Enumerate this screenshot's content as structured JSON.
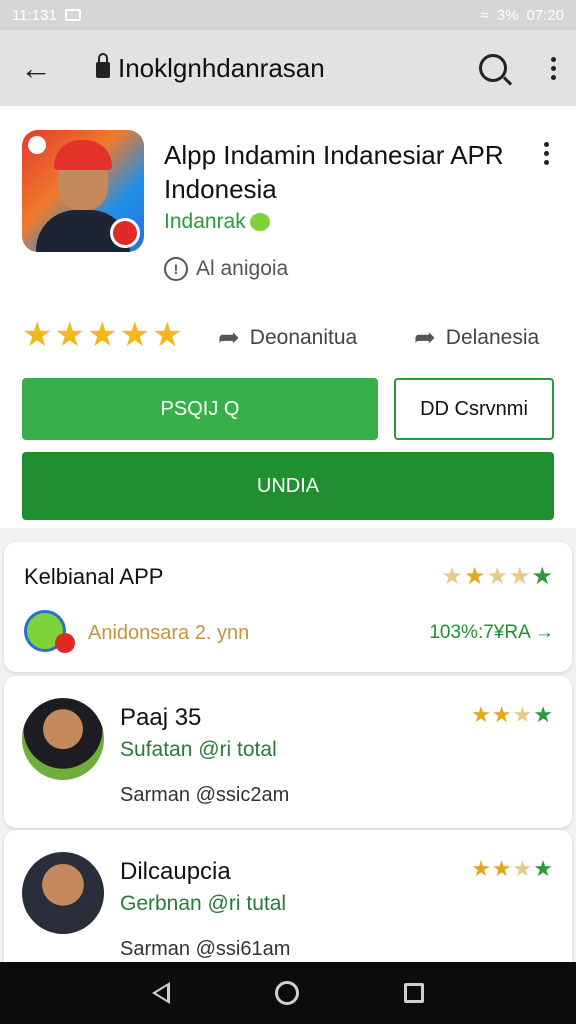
{
  "status_bar": {
    "time_left": "11:131",
    "battery": "3%",
    "time_right": "07:20"
  },
  "app_bar": {
    "url": "Inoklgnhdanrasan"
  },
  "app": {
    "title": "Alpp Indamin Indanesiar APR Indonesia",
    "developer": "Indanrak",
    "content_rating": "Al anigoia",
    "rating_stars": 5,
    "share_label": "Deonanitua",
    "share2_label": "Delanesia"
  },
  "buttons": {
    "install": "PSQIJ Q",
    "outline": "DD Csrvnmi",
    "open": "UNDIA"
  },
  "review_header": {
    "title": "Kelbianal APP",
    "subtitle": "Anidonsara 2. ynn",
    "count": "103%:7¥RA →"
  },
  "reviews": [
    {
      "name": "Paaj 35",
      "subtitle": "Sufatan @ri total",
      "meta": "Sarman @ssic2am"
    },
    {
      "name": "Dilcaupcia",
      "subtitle": "Gerbnan @ri tutal",
      "meta": "Sarman @ssi61am"
    }
  ],
  "colors": {
    "primary_green": "#38b04a",
    "dark_green": "#1f8f32",
    "star_gold": "#f3b81a"
  },
  "icons": [
    "back-arrow-icon",
    "lock-icon",
    "search-icon",
    "more-vert-icon",
    "info-icon",
    "share-icon",
    "star-icon"
  ]
}
